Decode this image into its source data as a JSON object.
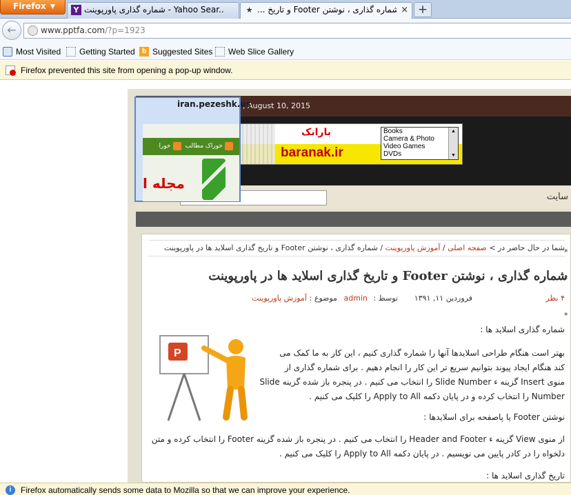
{
  "browser": {
    "menu_button": "Firefox",
    "tabs": [
      {
        "title": "شماره گذاری پاورپوینت - Yahoo Sear...",
        "favicon": "Y"
      },
      {
        "title": "... و تاریخ Footer شماره گذاری ، نوشتن",
        "favicon": "★"
      }
    ],
    "new_tab": "+",
    "url_host": "www.pptfa.com",
    "url_rest": "/?p=1923",
    "bookmarks": [
      "Most Visited",
      "Getting Started",
      "Suggested Sites",
      "Web Slice Gallery"
    ],
    "popup_notice": "Firefox prevented this site from opening a pop-up window.",
    "bottom_notice": "Firefox automatically sends some data to Mozilla so that we can improve your experience."
  },
  "site": {
    "date": ", August 10, 2015",
    "banner_fa": "بارانک",
    "banner_latin": "baranak.ir",
    "listbox_items": [
      "Books",
      "Camera & Photo",
      "Video Games",
      "DVDs"
    ],
    "site_link": "سایت",
    "breadcrumb_prefix": "شما در حال حاضر در >",
    "breadcrumb_home": "صفحه اصلی",
    "breadcrumb_sep": "/",
    "breadcrumb_category": "آموزش پاورپوینت",
    "breadcrumb_current": "شماره گذاری ، نوشتن Footer و تاریخ گذاری اسلاید ها در پاورپوینت",
    "post_title": "شماره گذاری ، نوشتن Footer و تاریخ گذاری اسلاید ها در پاورپوینت",
    "meta_comments": "۴ نظر",
    "meta_date": "فروردین ۱۱, ۱۳۹۱",
    "meta_by": "توسط :",
    "meta_author": "admin",
    "meta_topic": "موضوع :",
    "meta_category": "آموزش پاورپوینت",
    "para1_heading": "شماره گذاری اسلاید ها :",
    "para1_lines": [
      "بهتر است هنگام طراحی اسلایدها آنها را شماره گذاری کنیم ، این کار به ما کمک می",
      "کند هنگام ایجاد پیوند بتوانیم سریع تر این کار را انجام دهیم . برای شماره گذاری از",
      "منوی Insert گزینه ء Slide Number را انتخاب می کنیم . در پنجره باز شده گزینه Slide",
      "Number را انتخاب کرده و در پایان دکمه Apply to All را کلیک می کنیم ."
    ],
    "para2_heading": "نوشتن Footer یا پاصفحه برای اسلایدها :",
    "para2_lines": [
      "از منوی View گزینه ء Header and Footer را انتخاب می کنیم . در پنجره باز شده گزینه Footer را انتخاب کرده و متن",
      "دلخواه را در کادر پایین می نویسیم . در پایان دکمه Apply to All را کلیک می کنیم ."
    ],
    "para3_heading": "تاریخ گذاری اسلاید ها :",
    "sidebar_marks": [
      "*",
      "*",
      "*"
    ]
  },
  "preview": {
    "title": "iran.pezeshk.us",
    "rss_label_1": "خوراک مطالب",
    "rss_label_2": "خورا",
    "big_text": "مجله ا"
  }
}
